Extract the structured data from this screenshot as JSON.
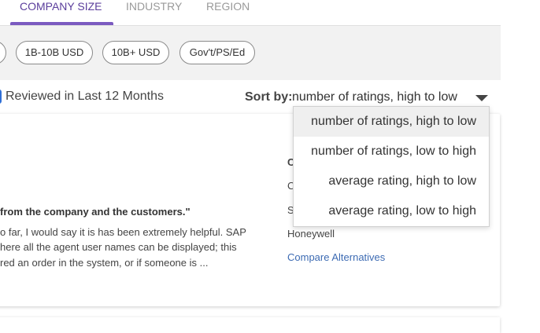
{
  "tabs": [
    {
      "label": "COMPANY SIZE",
      "active": true
    },
    {
      "label": "INDUSTRY",
      "active": false
    },
    {
      "label": "REGION",
      "active": false
    }
  ],
  "filters": [
    "1B-10B USD",
    "10B+ USD",
    "Gov't/PS/Ed"
  ],
  "review_filter": {
    "label": "Reviewed in Last 12 Months"
  },
  "sort": {
    "label": "Sort by:",
    "value": "number of ratings, high to low",
    "options": [
      "number of ratings, high to low",
      "number of ratings, low to high",
      "average rating, high to low",
      "average rating, low to high"
    ]
  },
  "review": {
    "headline": "from the company and the customers.\"",
    "body_lines": [
      "o far, I would say it is has been extremely helpful. SAP",
      "here all the agent user names can be displayed; this",
      "red an order in the system, or if someone is ..."
    ]
  },
  "reviewer": {
    "line1": "C",
    "line2": "C",
    "line3": "S",
    "company": "Honeywell",
    "compare_link": "Compare Alternatives"
  },
  "colors": {
    "accent": "#7b5bc0",
    "link": "#3d6bb3",
    "checkbox": "#2f6fd6"
  }
}
